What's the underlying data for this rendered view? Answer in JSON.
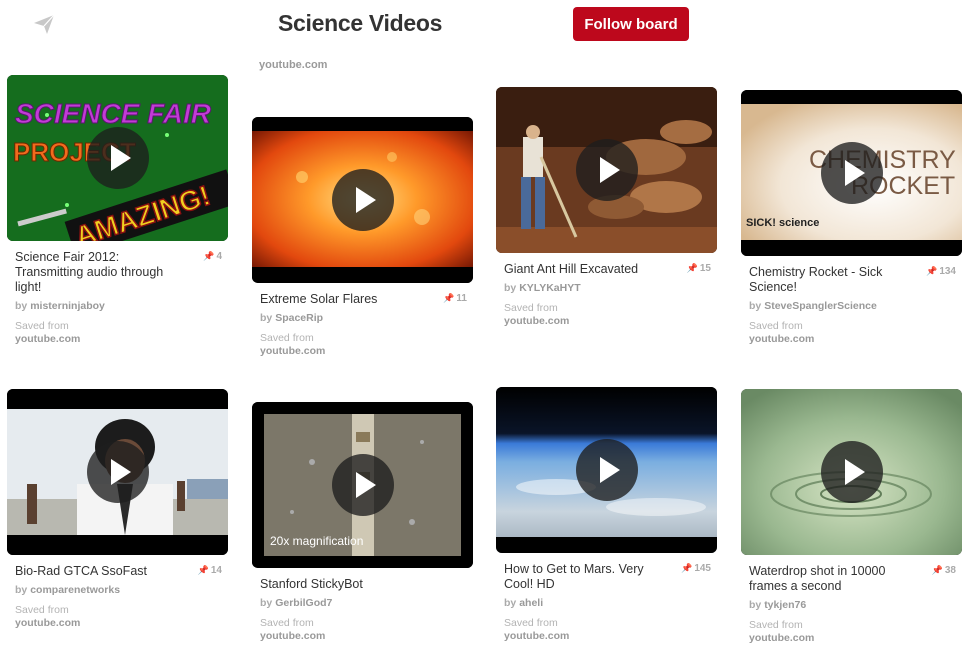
{
  "header": {
    "title": "Science Videos",
    "follow_label": "Follow board",
    "send_icon": "send-icon"
  },
  "ghost_text": {
    "col2_source": "youtube.com"
  },
  "colors": {
    "brand_red": "#bd081c",
    "text": "#333333",
    "muted": "#999999"
  },
  "pins": [
    {
      "title": "Science Fair 2012: Transmitting audio through light!",
      "count": "4",
      "author": "misterninjaboy",
      "saved_label": "Saved from",
      "source": "youtube.com",
      "art_text1": "SCIENCE FAIR",
      "art_text2": "PROJECT",
      "art_text3": "AMAZING!"
    },
    {
      "title": "Extreme Solar Flares",
      "count": "11",
      "author": "SpaceRip",
      "saved_label": "Saved from",
      "source": "youtube.com"
    },
    {
      "title": "Giant Ant Hill Excavated",
      "count": "15",
      "author": "KYLYKaHYT",
      "saved_label": "Saved from",
      "source": "youtube.com"
    },
    {
      "title": "Chemistry Rocket - Sick Science!",
      "count": "134",
      "author": "SteveSpanglerScience",
      "saved_label": "Saved from",
      "source": "youtube.com",
      "art_text1": "CHEMISTRY",
      "art_text2": "ROCKET",
      "art_text3": "SICK! science"
    },
    {
      "title": "Bio-Rad GTCA SsoFast",
      "count": "14",
      "author": "comparenetworks",
      "saved_label": "Saved from",
      "source": "youtube.com"
    },
    {
      "title": "Stanford StickyBot",
      "count": "",
      "author": "GerbilGod7",
      "saved_label": "Saved from",
      "source": "youtube.com",
      "art_text1": "20x magnification"
    },
    {
      "title": "How to Get to Mars. Very Cool! HD",
      "count": "145",
      "author": "aheli",
      "saved_label": "Saved from",
      "source": "youtube.com"
    },
    {
      "title": "Waterdrop shot in 10000 frames a second",
      "count": "38",
      "author": "tykjen76",
      "saved_label": "Saved from",
      "source": "youtube.com"
    }
  ],
  "by_label": "by"
}
